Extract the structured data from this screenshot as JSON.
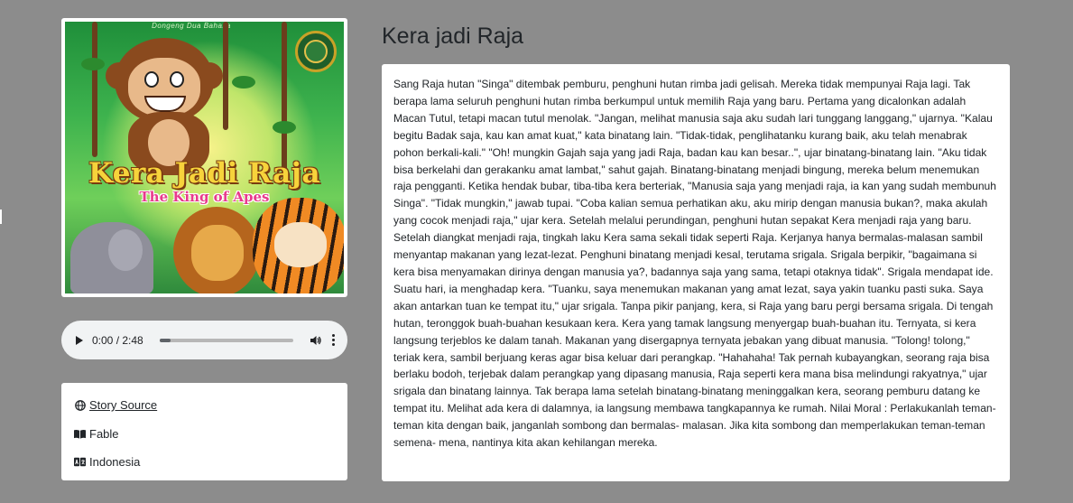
{
  "story": {
    "title": "Kera jadi Raja",
    "text": "Sang Raja hutan \"Singa\" ditembak pemburu, penghuni hutan rimba jadi gelisah. Mereka tidak mempunyai Raja lagi. Tak berapa lama seluruh penghuni hutan rimba berkumpul untuk memilih Raja yang baru. Pertama yang dicalonkan adalah Macan Tutul, tetapi macan tutul menolak. \"Jangan, melihat manusia saja aku sudah lari tunggang langgang,\" ujarnya. \"Kalau begitu Badak saja, kau kan amat kuat,\" kata binatang lain. \"Tidak-tidak, penglihatanku kurang baik, aku telah menabrak pohon berkali-kali.\" \"Oh! mungkin Gajah saja yang jadi Raja, badan kau kan besar..\", ujar binatang-binatang lain. \"Aku tidak bisa berkelahi dan gerakanku amat lambat,\" sahut gajah. Binatang-binatang menjadi bingung, mereka belum menemukan raja pengganti. Ketika hendak bubar, tiba-tiba kera berteriak, \"Manusia saja yang menjadi raja, ia kan yang sudah membunuh Singa\". \"Tidak mungkin,\" jawab tupai. \"Coba kalian semua perhatikan aku, aku mirip dengan manusia bukan?, maka akulah yang cocok menjadi raja,\" ujar kera. Setelah melalui perundingan, penghuni hutan sepakat Kera menjadi raja yang baru. Setelah diangkat menjadi raja, tingkah laku Kera sama sekali tidak seperti Raja. Kerjanya hanya bermalas-malasan sambil menyantap makanan yang lezat-lezat. Penghuni binatang menjadi kesal, terutama srigala. Srigala berpikir, \"bagaimana si kera bisa menyamakan dirinya dengan manusia ya?, badannya saja yang sama, tetapi otaknya tidak\". Srigala mendapat ide. Suatu hari, ia menghadap kera. \"Tuanku, saya menemukan makanan yang amat lezat, saya yakin tuanku pasti suka. Saya akan antarkan tuan ke tempat itu,\" ujar srigala. Tanpa pikir panjang, kera, si Raja yang baru pergi bersama srigala. Di tengah hutan, teronggok buah-buahan kesukaan kera. Kera yang tamak langsung menyergap buah-buahan itu. Ternyata, si kera langsung terjeblos ke dalam tanah. Makanan yang disergapnya ternyata jebakan yang dibuat manusia. \"Tolong! tolong,\" teriak kera, sambil berjuang keras agar bisa keluar dari perangkap. \"Hahahaha! Tak pernah kubayangkan, seorang raja bisa berlaku bodoh, terjebak dalam perangkap yang dipasang manusia, Raja seperti kera mana bisa melindungi rakyatnya,\" ujar srigala dan binatang lainnya. Tak berapa lama setelah binatang-binatang meninggalkan kera, seorang pemburu datang ke tempat itu. Melihat ada kera di dalamnya, ia langsung membawa tangkapannya ke rumah. Nilai Moral : Perlakukanlah teman-teman kita dengan baik, janganlah sombong dan bermalas- malasan. Jika kita sombong dan memperlakukan teman-teman semena- mena, nantinya kita akan kehilangan mereka."
  },
  "cover": {
    "top_text": "Dongeng Dua Bahasa",
    "title": "Kera Jadi Raja",
    "subtitle": "The King of Apes"
  },
  "audio": {
    "time": "0:00 / 2:48",
    "progress": 0.08,
    "play_icon": "play-icon",
    "volume_icon": "volume-icon",
    "menu_icon": "more-vert-icon"
  },
  "meta": {
    "source_label": "Story Source",
    "source_icon": "globe-icon",
    "genre": "Fable",
    "genre_icon": "open-book-icon",
    "language": "Indonesia",
    "language_icon": "translate-icon"
  },
  "colors": {
    "background": "#8c8c8c",
    "card": "#ffffff",
    "audio_bg": "#f1f3f4",
    "text": "#212529"
  }
}
